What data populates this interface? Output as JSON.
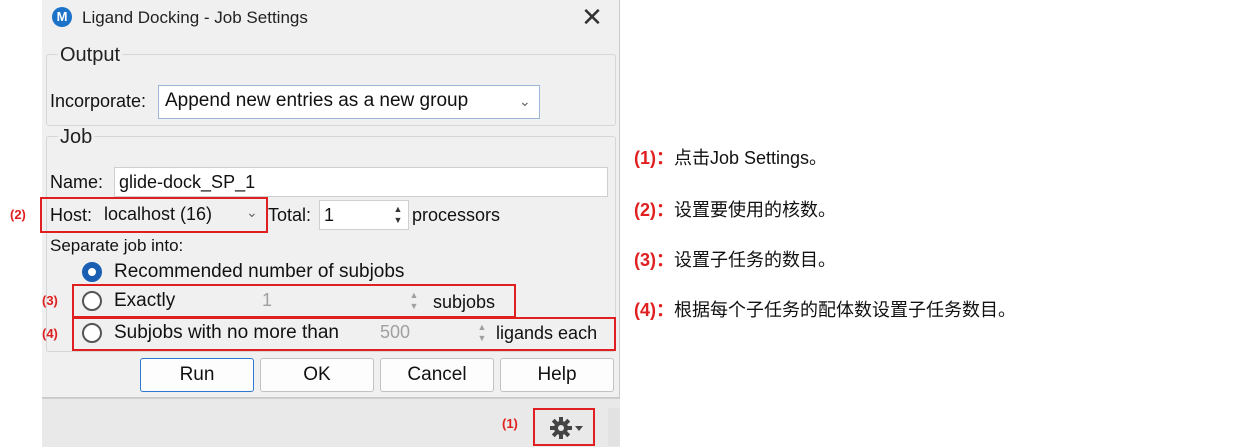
{
  "dialog": {
    "title": "Ligand Docking - Job Settings",
    "app_icon_letter": "M",
    "close_glyph": "✕"
  },
  "output": {
    "group_label": "Output",
    "incorporate_label": "Incorporate:",
    "incorporate_value": "Append new entries as a new group"
  },
  "job": {
    "group_label": "Job",
    "name_label": "Name:",
    "name_value": "glide-dock_SP_1",
    "host_label": "Host:",
    "host_value": "localhost (16)",
    "total_label": "Total:",
    "total_value": "1",
    "processors_label": "processors",
    "separate_label": "Separate job into:",
    "opt_recommended": "Recommended number of subjobs",
    "opt_exactly": "Exactly",
    "exactly_value": "1",
    "subjobs_label": "subjobs",
    "opt_no_more": "Subjobs with no more than",
    "no_more_value": "500",
    "ligands_label": "ligands each"
  },
  "buttons": {
    "run": "Run",
    "ok": "OK",
    "cancel": "Cancel",
    "help": "Help"
  },
  "markers": {
    "m1": "(1)",
    "m2": "(2)",
    "m3": "(3)",
    "m4": "(4)"
  },
  "annotations": [
    {
      "num": "(1)：",
      "text": "点击Job Settings。"
    },
    {
      "num": "(2)：",
      "text": "设置要使用的核数。"
    },
    {
      "num": "(3)：",
      "text": "设置子任务的数目。"
    },
    {
      "num": "(4)：",
      "text": "根据每个子任务的配体数设置子任务数目。"
    }
  ],
  "colors": {
    "accent": "#1a5fb4",
    "annotation_red": "#e02020"
  },
  "icons": {
    "gear": "gear-icon",
    "dropdown": "chevron-down-icon"
  }
}
